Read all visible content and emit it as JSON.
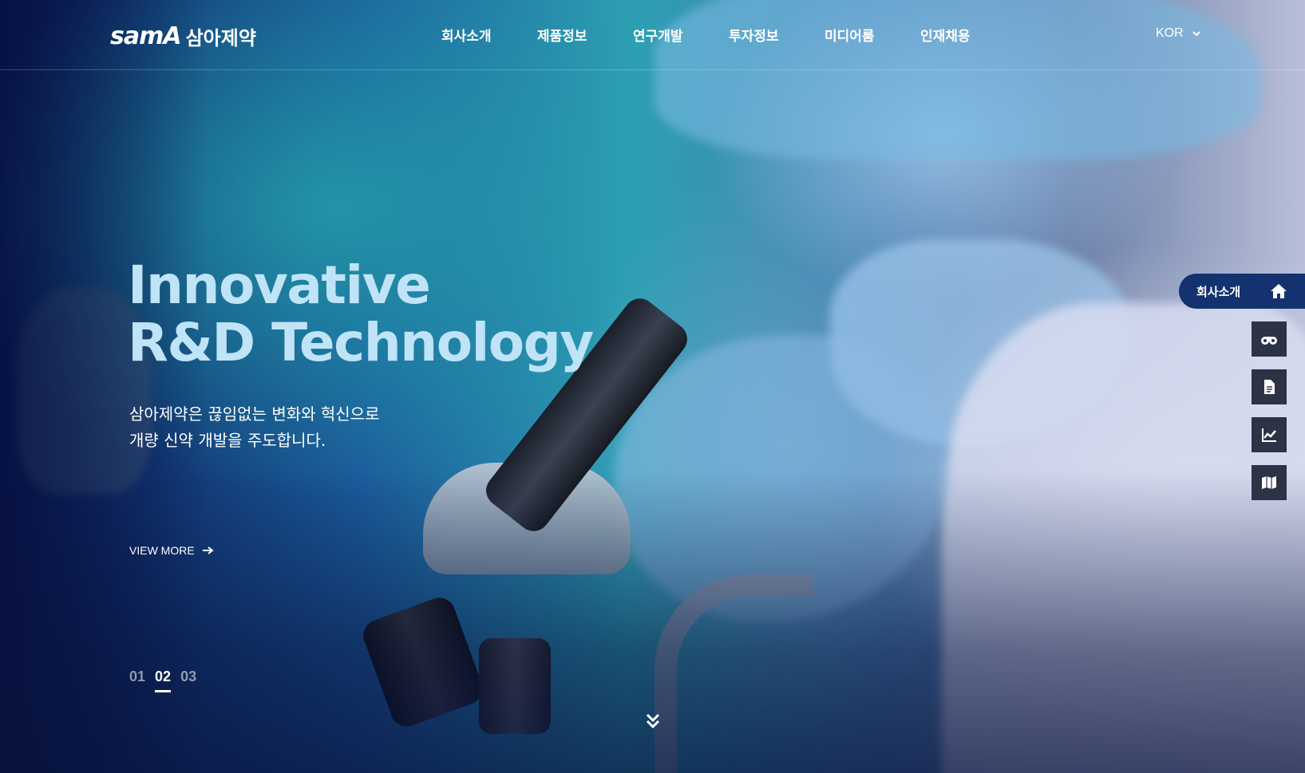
{
  "brand": {
    "logo_mark": "samA",
    "logo_text": "삼아제약"
  },
  "nav": [
    {
      "label": "회사소개"
    },
    {
      "label": "제품정보"
    },
    {
      "label": "연구개발"
    },
    {
      "label": "투자정보"
    },
    {
      "label": "미디어룸"
    },
    {
      "label": "인재채용"
    }
  ],
  "language": {
    "selected": "KOR"
  },
  "hero": {
    "headline_line1": "Innovative",
    "headline_line2": "R&D Technology",
    "sub_line1": "삼아제약은 끊임없는 변화와 혁신으로",
    "sub_line2": "개량 신약 개발을 주도합니다.",
    "cta": "VIEW MORE"
  },
  "slider": {
    "pages": [
      "01",
      "02",
      "03"
    ],
    "active_index": 1
  },
  "quick_menu": {
    "main_label": "회사소개",
    "icons": [
      "home-icon",
      "binoculars-icon",
      "document-icon",
      "chart-icon",
      "map-icon"
    ]
  },
  "colors": {
    "headline": "#bfe3f7",
    "quick_main_bg": "#13326f",
    "quick_btn_bg": "#2d3346"
  }
}
